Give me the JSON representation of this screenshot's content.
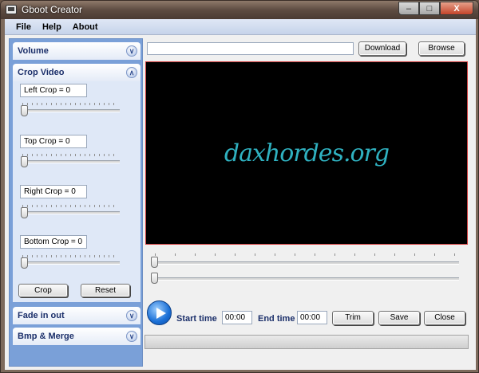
{
  "window": {
    "title": "Gboot Creator"
  },
  "titlebar_buttons": {
    "minimize": "–",
    "maximize": "□",
    "close": "X"
  },
  "menu": [
    "File",
    "Help",
    "About"
  ],
  "groups": {
    "volume": "Volume",
    "crop": "Crop Video",
    "fade": "Fade in out",
    "bmp": "Bmp & Merge"
  },
  "crop": {
    "left": "Left Crop = 0",
    "top": "Top Crop = 0",
    "right": "Right Crop = 0",
    "bottom": "Bottom Crop = 0",
    "crop_button": "Crop",
    "reset_button": "Reset"
  },
  "top": {
    "url_value": "",
    "download_button": "Download",
    "browse_button": "Browse"
  },
  "video": {
    "watermark": "daxhordes.org"
  },
  "controls": {
    "start_label": "Start time",
    "start_value": "00:00",
    "end_label": "End time",
    "end_value": "00:00",
    "trim_button": "Trim",
    "save_button": "Save",
    "close_button": "Close"
  },
  "colors": {
    "panel": "#7aa0d8",
    "video_border": "#d24040",
    "watermark": "#2fb1c0",
    "label_blue": "#1b2f6a"
  }
}
